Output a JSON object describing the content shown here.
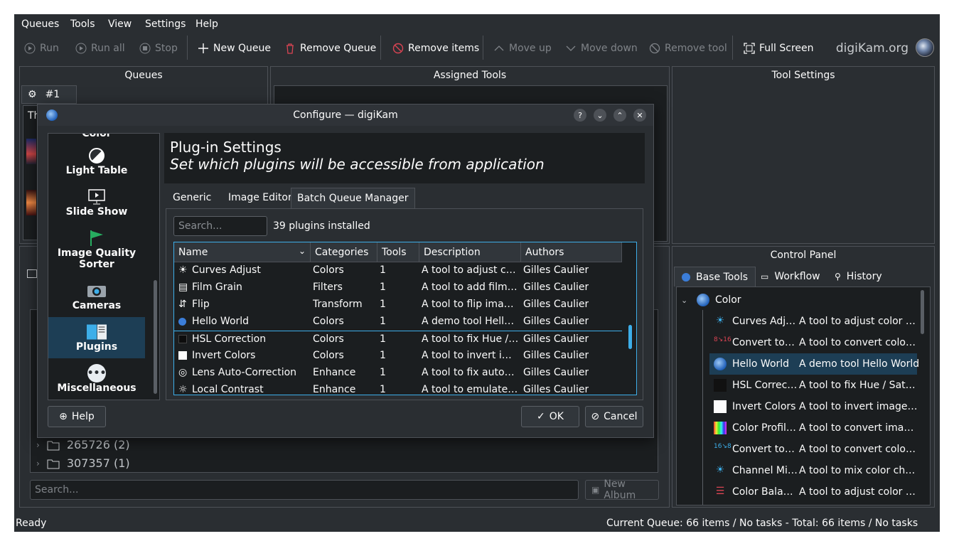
{
  "menu": [
    "Queues",
    "Tools",
    "View",
    "Settings",
    "Help"
  ],
  "toolbar": {
    "run": "Run",
    "run_all": "Run all",
    "stop": "Stop",
    "new_queue": "New Queue",
    "remove_queue": "Remove Queue",
    "remove_items": "Remove items",
    "move_up": "Move up",
    "move_down": "Move down",
    "remove_tool": "Remove tool",
    "full_screen": "Full Screen",
    "logo": "digiKam.org"
  },
  "panes": {
    "queues": "Queues",
    "queue_tab": "#1",
    "queue_clip": "Th",
    "assigned_tools": "Assigned Tools",
    "tool_settings": "Tool Settings",
    "control_panel": "Control Panel"
  },
  "albums": {
    "items": [
      {
        "label": "265726 (2)"
      },
      {
        "label": "307357 (1)"
      }
    ],
    "search_placeholder": "Search...",
    "new_album": "New Album"
  },
  "control_panel": {
    "tabs": [
      {
        "label": "Base Tools"
      },
      {
        "label": "Workflow"
      },
      {
        "label": "History"
      }
    ],
    "category": "Color",
    "tools": [
      {
        "name": "Curves Adjust",
        "desc": "A tool to adjust color cu…",
        "icon": "sun-icon"
      },
      {
        "name": "Convert to …",
        "desc": "A tool to convert color d…",
        "icon": "convert-bits-icon"
      },
      {
        "name": "Hello World",
        "desc": "A demo tool Hello World",
        "icon": "digikam-icon"
      },
      {
        "name": "HSL Correc…",
        "desc": "A tool to fix Hue / Satur…",
        "icon": "hsl-icon"
      },
      {
        "name": "Invert Colors",
        "desc": "A tool to invert image c…",
        "icon": "invert-icon"
      },
      {
        "name": "Color Profil…",
        "desc": "A tool to convert image…",
        "icon": "color-profile-icon"
      },
      {
        "name": "Convert to …",
        "desc": "A tool to convert color d…",
        "icon": "convert-bits-icon"
      },
      {
        "name": "Channel Mi…",
        "desc": "A tool to mix color chan…",
        "icon": "sun-icon"
      },
      {
        "name": "Color Balance",
        "desc": "A tool to adjust color ba…",
        "icon": "sliders-icon"
      }
    ]
  },
  "status": {
    "left": "Ready",
    "right": "Current Queue: 66 items / No tasks - Total: 66 items / No tasks"
  },
  "dialog": {
    "title": "Configure — digiKam",
    "sidebar": {
      "clipped": "Color Management",
      "items": [
        {
          "label": "Light Table"
        },
        {
          "label": "Slide Show"
        },
        {
          "label": "Image Quality Sorter"
        },
        {
          "label": "Cameras"
        },
        {
          "label": "Plugins"
        },
        {
          "label": "Miscellaneous"
        }
      ]
    },
    "header_title": "Plug-in Settings",
    "header_subtitle": "Set which plugins will be accessible from application",
    "tabs": [
      {
        "label": "Generic"
      },
      {
        "label": "Image Editor"
      },
      {
        "label": "Batch Queue Manager"
      }
    ],
    "search_placeholder": "Search...",
    "count_text": "39 plugins installed",
    "columns": [
      "Name",
      "Categories",
      "Tools",
      "Description",
      "Authors"
    ],
    "rows": [
      {
        "name": "Curves Adjust",
        "category": "Colors",
        "tools": "1",
        "desc": "A tool to adjust colo…",
        "author": "Gilles Caulier"
      },
      {
        "name": "Film Grain",
        "category": "Filters",
        "tools": "1",
        "desc": "A tool to add film gr…",
        "author": "Gilles Caulier"
      },
      {
        "name": "Flip",
        "category": "Transform",
        "tools": "1",
        "desc": "A tool to flip images…",
        "author": "Gilles Caulier"
      },
      {
        "name": "Hello World",
        "category": "Colors",
        "tools": "1",
        "desc": "A demo tool Hello …",
        "author": "Gilles Caulier"
      },
      {
        "name": "HSL Correction",
        "category": "Colors",
        "tools": "1",
        "desc": "A tool to fix Hue / S…",
        "author": "Gilles Caulier"
      },
      {
        "name": "Invert Colors",
        "category": "Colors",
        "tools": "1",
        "desc": "A tool to invert imag…",
        "author": "Gilles Caulier"
      },
      {
        "name": "Lens Auto-Correction",
        "category": "Enhance",
        "tools": "1",
        "desc": "A tool to fix automat…",
        "author": "Gilles Caulier"
      },
      {
        "name": "Local Contrast",
        "category": "Enhance",
        "tools": "1",
        "desc": "A tool to emulate to…",
        "author": "Gilles Caulier"
      }
    ],
    "help": "Help",
    "ok": "OK",
    "cancel": "Cancel"
  },
  "colors": {
    "accent": "#3daee9",
    "selection": "#1d3e55",
    "background": "#2a2e32"
  }
}
